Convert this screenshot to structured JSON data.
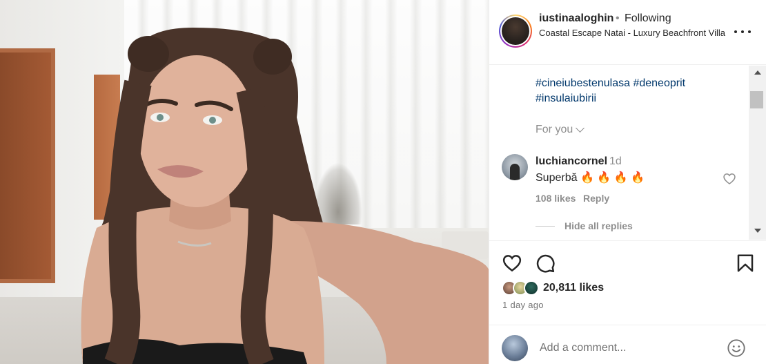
{
  "post": {
    "username": "iustinaaloghin",
    "separator": "•",
    "follow_status": "Following",
    "location": "Coastal Escape Natai - Luxury Beachfront Villa"
  },
  "caption": {
    "hashtags": [
      "#cineiubestenulasa",
      "#deneoprit",
      "#insulaiubirii"
    ]
  },
  "comments_section": {
    "for_you_label": "For you",
    "comment": {
      "username": "luchiancornel",
      "time": "1d",
      "text": "Superbă 🔥 🔥 🔥 🔥",
      "likes": "108 likes",
      "reply_label": "Reply"
    },
    "hide_replies_label": "Hide all replies"
  },
  "engagement": {
    "likes": "20,811 likes",
    "posted": "1 day ago"
  },
  "composer": {
    "placeholder": "Add a comment..."
  },
  "icons": {
    "more": "more-horizontal-icon",
    "like": "heart-icon",
    "comment": "comment-icon",
    "save": "bookmark-icon",
    "emoji": "emoji-icon",
    "chevron": "chevron-down-icon"
  },
  "colors": {
    "hashtag": "#00376b",
    "text": "#262626",
    "muted": "#8e8e8e"
  }
}
